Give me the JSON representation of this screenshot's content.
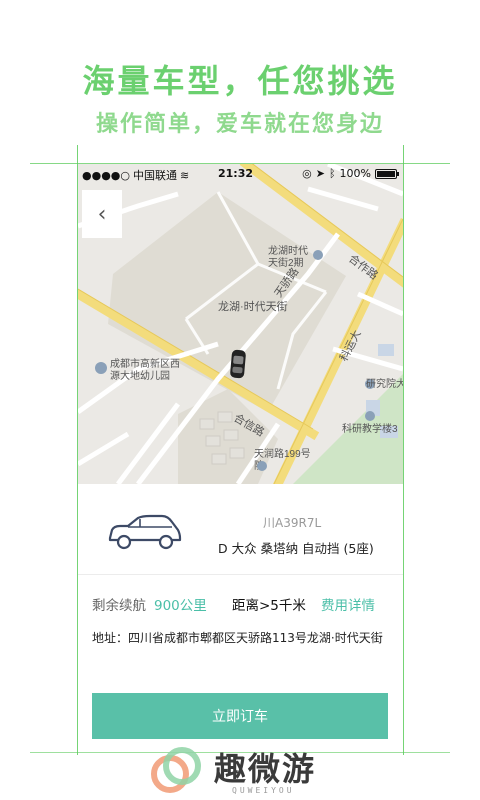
{
  "banner": {
    "headline": "海量车型，任您挑选",
    "subline": "操作简单，爱车就在您身边"
  },
  "status_bar": {
    "carrier": "中国联通",
    "time": "21:32",
    "battery": "100%",
    "battery_level": 1.0
  },
  "map": {
    "labels": {
      "road_hexin_top": "合作路",
      "road_hexin_bottom": "合信路",
      "road_tianjiao": "天骄路",
      "road_keyun": "科运大",
      "poi_longhu_2": "龙湖时代\n天街2期",
      "poi_longhu": "龙湖·时代天街",
      "poi_kindergarten": "成都市高新区西\n源大地幼儿园",
      "poi_research": "研究院大",
      "poi_teaching": "科研教学楼3",
      "poi_tianrun": "天润路199号\n院"
    }
  },
  "car": {
    "plate": "川A39R7L",
    "name": "D 大众 桑塔纳 自动挡 (5座)"
  },
  "info": {
    "range_label": "剩余续航",
    "range_value": "900公里",
    "distance": "距离>5千米",
    "fee_link": "费用详情"
  },
  "address": "地址：四川省成都市郫都区天骄路113号龙湖·时代天街",
  "order_button": "立即订车",
  "brand": {
    "name": "趣微游",
    "sub": "QUWEIYOU"
  },
  "colors": {
    "accent": "#59c0a8",
    "headline": "#6bd06f",
    "map_bg": "#ebe9e5"
  }
}
